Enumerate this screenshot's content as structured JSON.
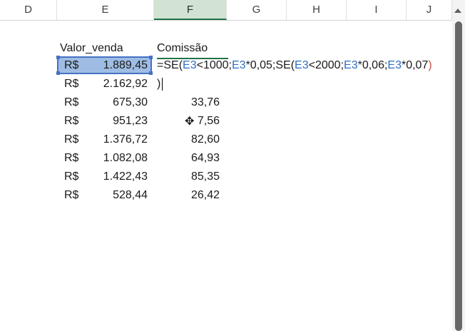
{
  "columns": [
    "D",
    "E",
    "F",
    "G",
    "H",
    "I",
    "J"
  ],
  "active_column": "F",
  "headers": {
    "valor": "Valor_venda",
    "comissao": "Comissão"
  },
  "currency": "R$",
  "rows": [
    {
      "valor": "1.889,45",
      "comissao": ""
    },
    {
      "valor": "2.162,92",
      "comissao": ""
    },
    {
      "valor": "675,30",
      "comissao": "33,76"
    },
    {
      "valor": "951,23",
      "comissao": "7,56"
    },
    {
      "valor": "1.376,72",
      "comissao": "82,60"
    },
    {
      "valor": "1.082,08",
      "comissao": "64,93"
    },
    {
      "valor": "1.422,43",
      "comissao": "85,35"
    },
    {
      "valor": "528,44",
      "comissao": "26,42"
    }
  ],
  "formula": {
    "p1": "=SE(",
    "r1": "E3",
    "p2": "<1000;",
    "r2": "E3",
    "p3": "*0,05;SE(",
    "r3": "E3",
    "p4": "<2000;",
    "r4": "E3",
    "p5": "*0,06;",
    "r5": "E3",
    "p6": "*0,07",
    "close1": ")",
    "close2": ")"
  },
  "cursor_icon": "move-cursor-icon",
  "colors": {
    "selection_fill": "#9fbde4",
    "selection_border": "#4472c4",
    "ref_blue": "#2f6fc4",
    "paren_red": "#c0504d",
    "header_green": "#217346"
  }
}
